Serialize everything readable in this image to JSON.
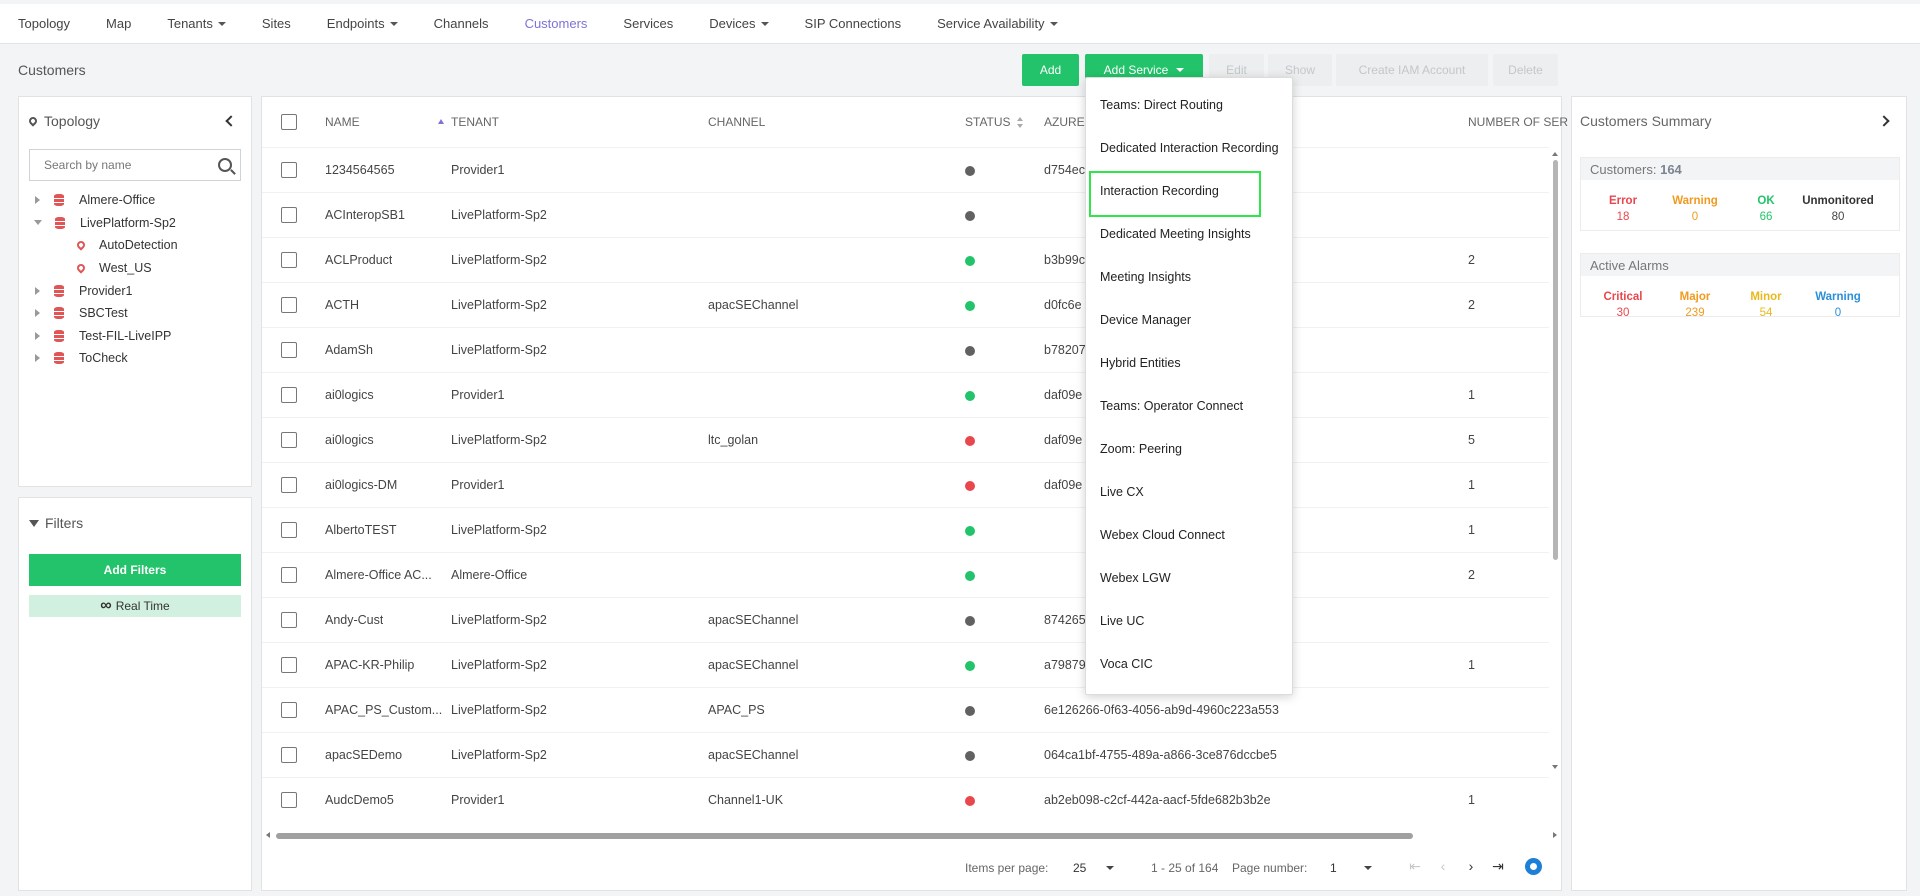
{
  "nav": [
    {
      "label": "Topology",
      "caret": false,
      "active": false
    },
    {
      "label": "Map",
      "caret": false,
      "active": false
    },
    {
      "label": "Tenants",
      "caret": true,
      "active": false
    },
    {
      "label": "Sites",
      "caret": false,
      "active": false
    },
    {
      "label": "Endpoints",
      "caret": true,
      "active": false
    },
    {
      "label": "Channels",
      "caret": false,
      "active": false
    },
    {
      "label": "Customers",
      "caret": false,
      "active": true
    },
    {
      "label": "Services",
      "caret": false,
      "active": false
    },
    {
      "label": "Devices",
      "caret": true,
      "active": false
    },
    {
      "label": "SIP Connections",
      "caret": false,
      "active": false
    },
    {
      "label": "Service Availability",
      "caret": true,
      "active": false
    }
  ],
  "page": {
    "title": "Customers"
  },
  "actions": {
    "add": "Add",
    "add_service": "Add Service",
    "edit": "Edit",
    "show": "Show",
    "create_iam": "Create IAM Account",
    "delete": "Delete"
  },
  "topology": {
    "title": "Topology",
    "search_placeholder": "Search by name",
    "nodes": [
      {
        "label": "Almere-Office",
        "type": "tenant",
        "expanded": false
      },
      {
        "label": "LivePlatform-Sp2",
        "type": "tenant",
        "expanded": true
      },
      {
        "label": "AutoDetection",
        "type": "region"
      },
      {
        "label": "West_US",
        "type": "region"
      },
      {
        "label": "Provider1",
        "type": "tenant",
        "expanded": false
      },
      {
        "label": "SBCTest",
        "type": "tenant",
        "expanded": false
      },
      {
        "label": "Test-FIL-LiveIPP",
        "type": "tenant",
        "expanded": false
      },
      {
        "label": "ToCheck",
        "type": "tenant",
        "expanded": false
      }
    ]
  },
  "filters": {
    "title": "Filters",
    "add_label": "Add Filters",
    "realtime_label": "Real Time"
  },
  "table": {
    "headers": {
      "name": "NAME",
      "tenant": "TENANT",
      "channel": "CHANNEL",
      "status": "STATUS",
      "azure": "AZURE",
      "num_services": "NUMBER OF SER"
    },
    "rows": [
      {
        "name": "1234564565",
        "tenant": "Provider1",
        "channel": "",
        "status": "gray",
        "azure": "d754ec",
        "num": ""
      },
      {
        "name": "ACInteropSB1",
        "tenant": "LivePlatform-Sp2",
        "channel": "",
        "status": "gray",
        "azure": "",
        "num": ""
      },
      {
        "name": "ACLProduct",
        "tenant": "LivePlatform-Sp2",
        "channel": "",
        "status": "green",
        "azure": "b3b99c",
        "num": "2"
      },
      {
        "name": "ACTH",
        "tenant": "LivePlatform-Sp2",
        "channel": "apacSEChannel",
        "status": "green",
        "azure": "d0fc6e",
        "num": "2"
      },
      {
        "name": "AdamSh",
        "tenant": "LivePlatform-Sp2",
        "channel": "",
        "status": "gray",
        "azure": "b78207",
        "num": ""
      },
      {
        "name": "ai0logics",
        "tenant": "Provider1",
        "channel": "",
        "status": "green",
        "azure": "daf09e",
        "num": "1"
      },
      {
        "name": "ai0logics",
        "tenant": "LivePlatform-Sp2",
        "channel": "ltc_golan",
        "status": "red",
        "azure": "daf09e",
        "num": "5"
      },
      {
        "name": "ai0logics-DM",
        "tenant": "Provider1",
        "channel": "",
        "status": "red",
        "azure": "daf09e",
        "num": "1"
      },
      {
        "name": "AlbertoTEST",
        "tenant": "LivePlatform-Sp2",
        "channel": "",
        "status": "green",
        "azure": "",
        "num": "1"
      },
      {
        "name": "Almere-Office AC...",
        "tenant": "Almere-Office",
        "channel": "",
        "status": "green",
        "azure": "",
        "num": "2"
      },
      {
        "name": "Andy-Cust",
        "tenant": "LivePlatform-Sp2",
        "channel": "apacSEChannel",
        "status": "gray",
        "azure": "874265",
        "num": ""
      },
      {
        "name": "APAC-KR-Philip",
        "tenant": "LivePlatform-Sp2",
        "channel": "apacSEChannel",
        "status": "green",
        "azure": "a79879",
        "num": "1"
      },
      {
        "name": "APAC_PS_Custom...",
        "tenant": "LivePlatform-Sp2",
        "channel": "APAC_PS",
        "status": "gray",
        "azure": "6e126266-0f63-4056-ab9d-4960c223a553",
        "num": ""
      },
      {
        "name": "apacSEDemo",
        "tenant": "LivePlatform-Sp2",
        "channel": "apacSEChannel",
        "status": "gray",
        "azure": "064ca1bf-4755-489a-a866-3ce876dccbe5",
        "num": ""
      },
      {
        "name": "AudcDemo5",
        "tenant": "Provider1",
        "channel": "Channel1-UK",
        "status": "red",
        "azure": "ab2eb098-c2cf-442a-aacf-5fde682b3b2e",
        "num": "1"
      }
    ]
  },
  "pagination": {
    "items_per_page_label": "Items per page:",
    "items_per_page": "25",
    "range": "1 - 25 of 164",
    "page_number_label": "Page number:",
    "page_number": "1"
  },
  "add_service_menu": {
    "items": [
      "Teams: Direct Routing",
      "Dedicated Interaction Recording",
      "Interaction Recording",
      "Dedicated Meeting Insights",
      "Meeting Insights",
      "Device Manager",
      "Hybrid Entities",
      "Teams: Operator Connect",
      "Zoom: Peering",
      "Live CX",
      "Webex Cloud Connect",
      "Webex LGW",
      "Live UC",
      "Voca CIC"
    ],
    "highlighted": "Interaction Recording"
  },
  "summary": {
    "title": "Customers Summary",
    "customers_label": "Customers:",
    "customers_count": "164",
    "customer_stats": [
      {
        "label": "Error",
        "value": "18",
        "color": "#e8474d"
      },
      {
        "label": "Warning",
        "value": "0",
        "color": "#f29a1f"
      },
      {
        "label": "OK",
        "value": "66",
        "color": "#22c36a"
      },
      {
        "label": "Unmonitored",
        "value": "80",
        "color": "#444444"
      }
    ],
    "alarms_label": "Active Alarms",
    "alarm_stats": [
      {
        "label": "Critical",
        "value": "30",
        "color": "#e8474d"
      },
      {
        "label": "Major",
        "value": "239",
        "color": "#f29a1f"
      },
      {
        "label": "Minor",
        "value": "54",
        "color": "#e8b91c"
      },
      {
        "label": "Warning",
        "value": "0",
        "color": "#2b90d9"
      }
    ]
  },
  "status_colors": {
    "gray": "#616161",
    "green": "#22c36a",
    "red": "#e8474d"
  }
}
